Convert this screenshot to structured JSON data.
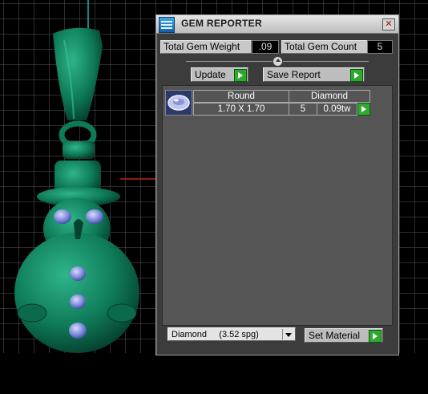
{
  "window": {
    "title": "GEM REPORTER",
    "close_label": "✕"
  },
  "totals": {
    "weight_label": "Total Gem Weight",
    "weight_value": ".09",
    "count_label": "Total Gem Count",
    "count_value": "5"
  },
  "actions": {
    "update_label": "Update",
    "save_report_label": "Save Report",
    "set_material_label": "Set Material"
  },
  "gems": [
    {
      "shape": "Round",
      "size": "1.70 X 1.70",
      "material": "Diamond",
      "count": "5",
      "weight": "0.09tw"
    }
  ],
  "material_select": {
    "selected": "Diamond     (3.52 spg)"
  },
  "colors": {
    "model": "#0f7a5a",
    "gem": "#7f8bd8",
    "grid": "#6a6a6a",
    "axis_cyan": "#18b4b4",
    "axis_red": "#c02020"
  }
}
